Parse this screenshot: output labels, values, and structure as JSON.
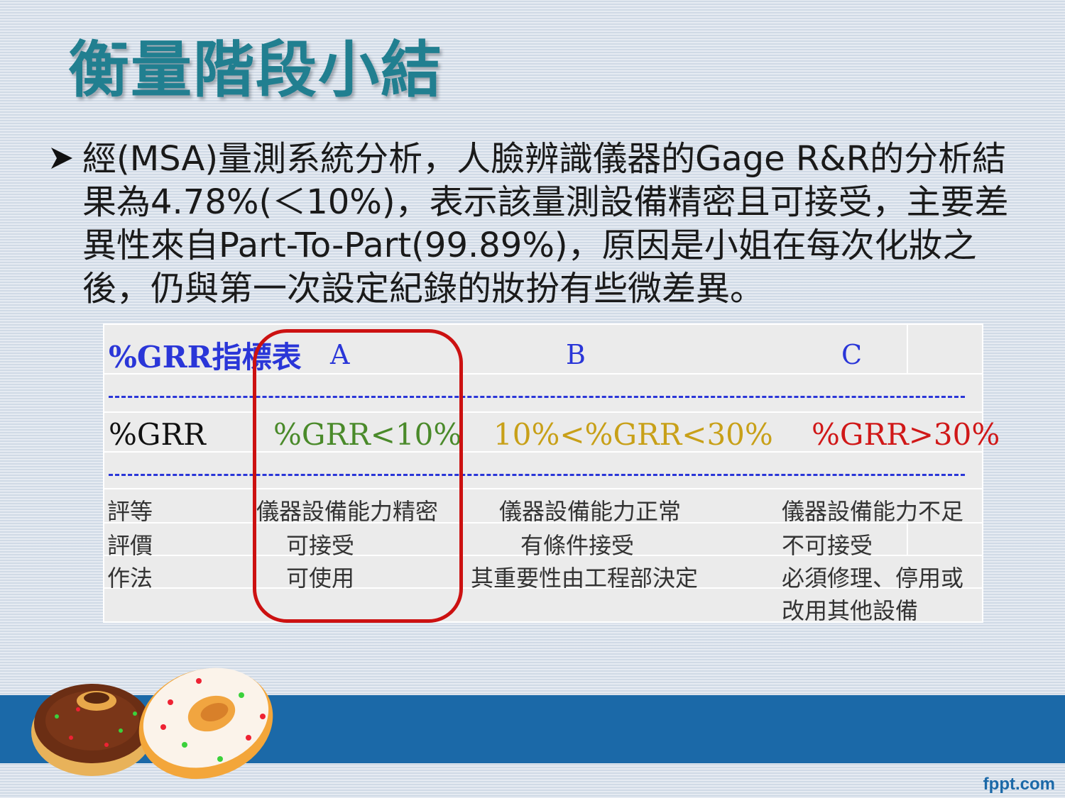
{
  "title": "衡量階段小結",
  "bullet": {
    "line1": "經(MSA)量測系統分析，人臉辨識儀器的Gage R&R的分析結",
    "line2": "果為4.78%(＜10%)，表示該量測設備精密且可接受，主要差",
    "line3": "異性來自Part-To-Part(99.89%)，原因是小姐在每次化妝之",
    "line4": "後，仍與第一次設定紀錄的妝扮有些微差異。"
  },
  "table": {
    "title": "%GRR指標表",
    "cols": [
      "A",
      "B",
      "C"
    ],
    "grr_label": "%GRR",
    "grr_values": [
      "%GRR<10%",
      "10%<%GRR<30%",
      "%GRR>30%"
    ],
    "grr_colors": [
      "#4a8a2a",
      "#c8a018",
      "#d01818"
    ],
    "rows": [
      {
        "label": "評等",
        "a": "儀器設備能力精密",
        "b": "儀器設備能力正常",
        "c": "儀器設備能力不足"
      },
      {
        "label": "評價",
        "a": "可接受",
        "b": "有條件接受",
        "c": "不可接受"
      },
      {
        "label": "作法",
        "a": "可使用",
        "b": "其重要性由工程部決定",
        "c": "必須修理、停用或"
      },
      {
        "label": "",
        "a": "",
        "b": "",
        "c": "改用其他設備"
      }
    ]
  },
  "footer": {
    "logo": "fppt.com"
  },
  "icons": {
    "bullet": "arrow-bullet-icon",
    "donuts": "donuts-illustration"
  }
}
